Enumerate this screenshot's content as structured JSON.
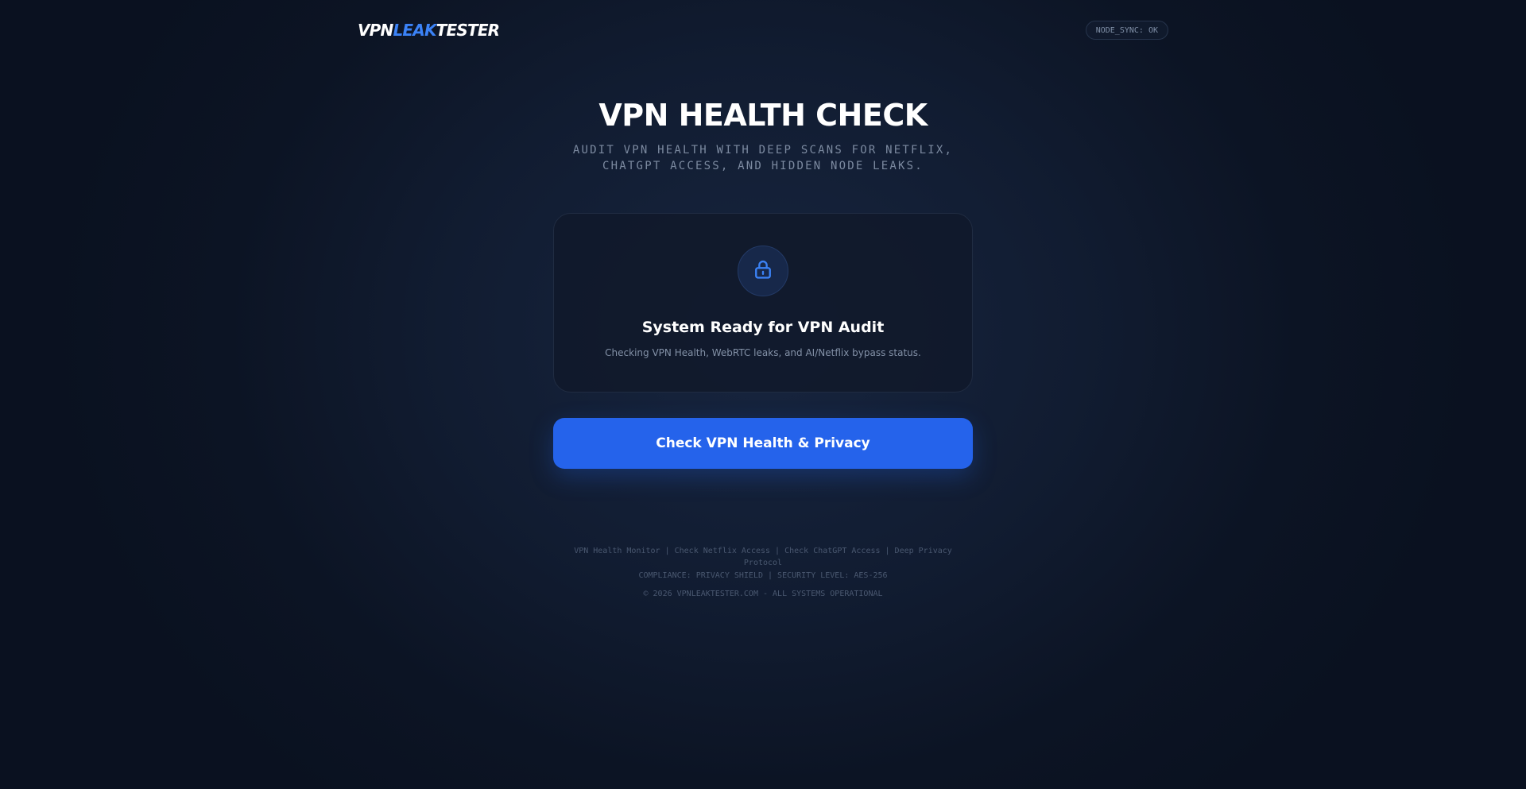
{
  "header": {
    "logo_part1": "VPN",
    "logo_part2": "LEAK",
    "logo_part3": "TESTER",
    "status": "NODE_SYNC: OK"
  },
  "main": {
    "title": "VPN HEALTH CHECK",
    "subtitle": "AUDIT VPN HEALTH WITH DEEP SCANS FOR NETFLIX, CHATGPT ACCESS, AND HIDDEN NODE LEAKS."
  },
  "card": {
    "icon": "lock-icon",
    "title": "System Ready for VPN Audit",
    "description": "Checking VPN Health, WebRTC leaks, and AI/Netflix bypass status."
  },
  "cta": {
    "label": "Check VPN Health & Privacy"
  },
  "footer": {
    "links": "VPN Health Monitor | Check Netflix Access | Check ChatGPT Access | Deep Privacy Protocol",
    "compliance": "COMPLIANCE: PRIVACY SHIELD | SECURITY LEVEL: AES-256",
    "copyright": "© 2026 VPNLEAKTESTER.COM - ALL SYSTEMS OPERATIONAL"
  },
  "colors": {
    "accent": "#2563eb",
    "accent_light": "#3b82f6",
    "background": "#0f1a2e"
  }
}
